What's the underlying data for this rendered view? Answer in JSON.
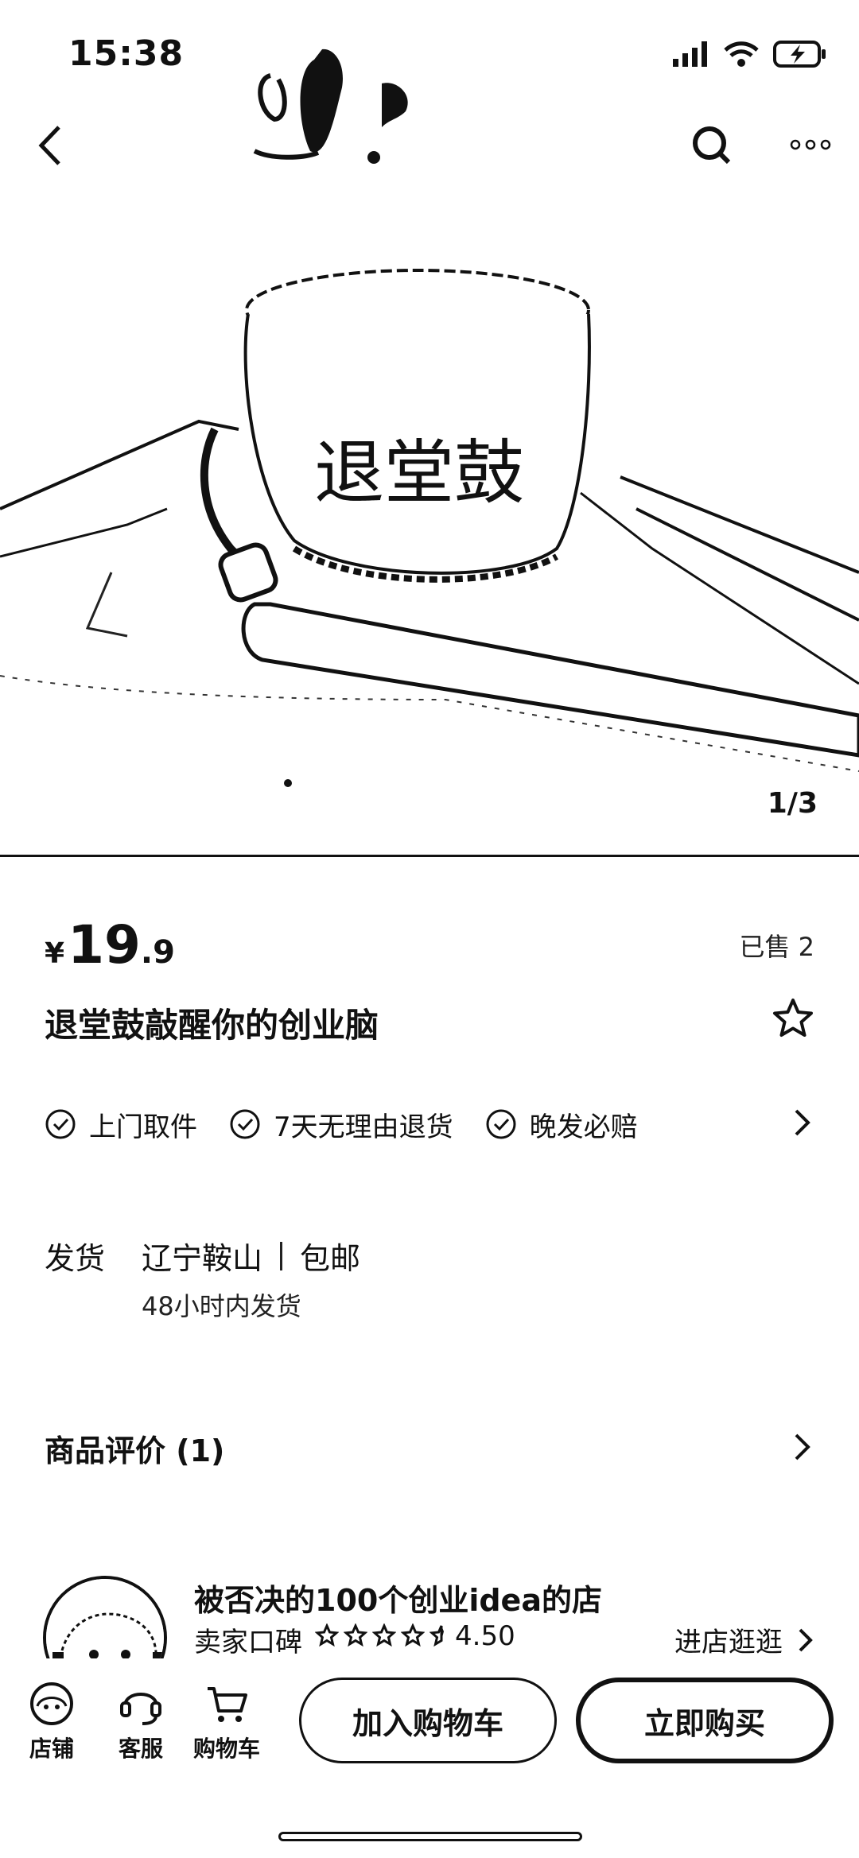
{
  "status_bar": {
    "time": "15:38"
  },
  "hero": {
    "image_label": "退堂鼓",
    "counter": "1/3"
  },
  "product": {
    "price_symbol": "¥",
    "price_integer": "19",
    "price_decimal": ".9",
    "sold": "已售 2",
    "title": "退堂鼓敲醒你的创业脑"
  },
  "guarantees": [
    {
      "label": "上门取件"
    },
    {
      "label": "7天无理由退货"
    },
    {
      "label": "晚发必赔"
    }
  ],
  "shipping": {
    "label": "发货",
    "origin": "辽宁鞍山",
    "fee": "包邮",
    "time": "48小时内发货"
  },
  "reviews": {
    "label": "商品评价 (1)"
  },
  "shop": {
    "name": "被否决的100个创业idea的店",
    "rating_label": "卖家口碑",
    "rating_value": 4.5,
    "rating_text": "4.50",
    "enter_label": "进店逛逛"
  },
  "bottom_bar": {
    "store_label": "店铺",
    "service_label": "客服",
    "cart_label": "购物车",
    "add_to_cart": "加入购物车",
    "buy_now": "立即购买"
  },
  "colors": {
    "ink": "#111111",
    "background": "#ffffff"
  }
}
